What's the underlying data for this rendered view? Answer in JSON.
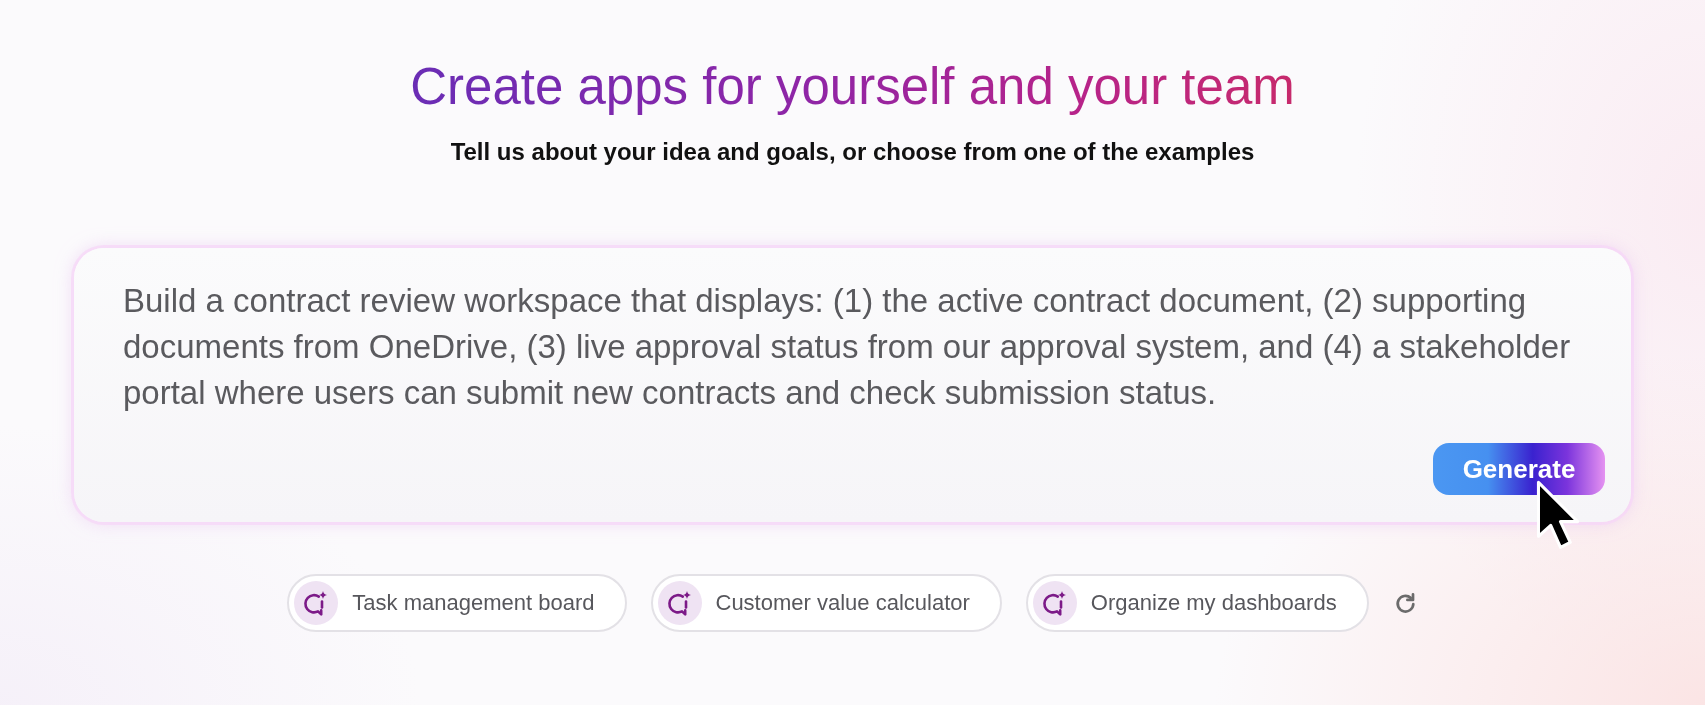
{
  "header": {
    "title": "Create apps for yourself and your team",
    "subtitle": "Tell us about your idea and goals, or choose from one of the examples"
  },
  "prompt": {
    "value": "Build a contract review workspace that displays: (1) the active contract document, (2) supporting documents from OneDrive, (3) live approval status from our approval system, and (4) a stakeholder portal where users can submit new contracts and check submission status.",
    "generate_button": "Generate"
  },
  "examples": [
    {
      "label": "Task management board"
    },
    {
      "label": "Customer value calculator"
    },
    {
      "label": "Organize my dashboards"
    }
  ]
}
